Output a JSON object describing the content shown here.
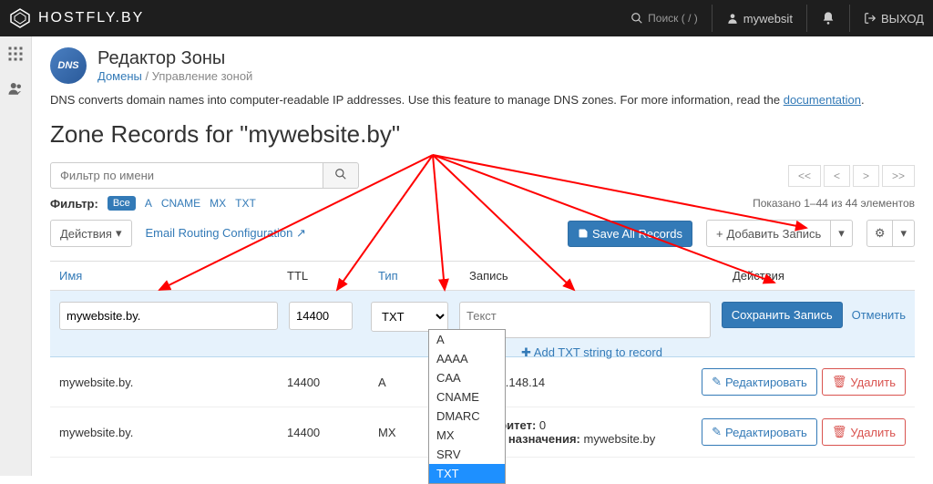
{
  "top": {
    "logo_text": "HOSTFLY.BY",
    "search_placeholder": "Поиск ( / )",
    "user": "mywebsit",
    "logout": "ВЫХОД"
  },
  "page": {
    "title": "Редактор Зоны",
    "crumb_domains": "Домены",
    "crumb_current": "Управление зоной",
    "desc_prefix": "DNS converts domain names into computer-readable IP addresses. Use this feature to manage DNS zones. For more information, read the ",
    "desc_link": "documentation",
    "zone_heading": "Zone Records for \"mywebsite.by\""
  },
  "filter": {
    "placeholder": "Фильтр по имени",
    "label": "Фильтр:",
    "all": "Все",
    "types": [
      "A",
      "CNAME",
      "MX",
      "TXT"
    ],
    "shown": "Показано 1–44 из 44 элементов"
  },
  "pager": {
    "first": "<<",
    "prev": "<",
    "next": ">",
    "last": ">>"
  },
  "actions": {
    "dropdown": "Действия",
    "email_routing": "Email Routing Configuration",
    "save_all": "Save All Records",
    "add": "Добавить Запись",
    "gear": "⚙"
  },
  "head": {
    "name": "Имя",
    "ttl": "TTL",
    "type": "Тип",
    "record": "Запись",
    "actions": "Действия"
  },
  "edit": {
    "name": "mywebsite.by.",
    "ttl": "14400",
    "type_selected": "TXT",
    "record_placeholder": "Текст",
    "add_txt": "Add TXT string to record",
    "save": "Сохранить Запись",
    "cancel": "Отменить"
  },
  "type_options": [
    "A",
    "AAAA",
    "CAA",
    "CNAME",
    "DMARC",
    "MX",
    "SRV",
    "TXT"
  ],
  "rows": [
    {
      "name": "mywebsite.by.",
      "ttl": "14400",
      "type": "A",
      "record": "85.209.148.14"
    },
    {
      "name": "mywebsite.by.",
      "ttl": "14400",
      "type": "MX",
      "record_priority_label": "Приоритет:",
      "record_priority": "0",
      "record_dest_label": "Место назначения:",
      "record_dest": "mywebsite.by"
    }
  ],
  "row_buttons": {
    "edit": "Редактировать",
    "del": "Удалить"
  }
}
